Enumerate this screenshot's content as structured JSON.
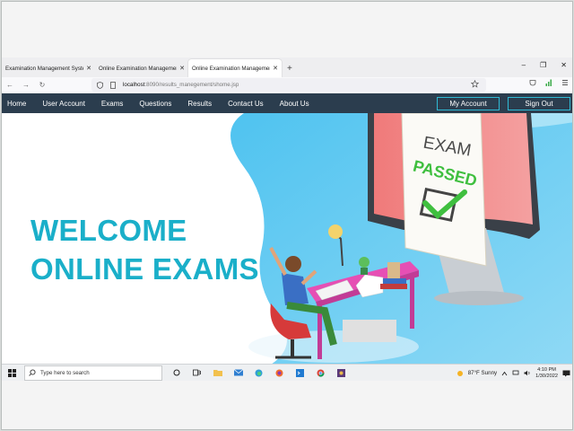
{
  "browser": {
    "tabs": [
      {
        "label": "Examination Management System",
        "active": false
      },
      {
        "label": "Online Examination Management S",
        "active": false
      },
      {
        "label": "Online Examination Management S",
        "active": true
      }
    ],
    "close_glyph": "✕",
    "new_tab_glyph": "+",
    "window_controls": [
      "–",
      "❐",
      "✕"
    ],
    "url_host": "localhost",
    "url_path": ":8090/results_manegement/shome.jsp",
    "nav": {
      "back": "←",
      "forward": "→",
      "reload": "↻"
    }
  },
  "site": {
    "nav_items": [
      "Home",
      "User Account",
      "Exams",
      "Questions",
      "Results",
      "Contact Us",
      "About Us"
    ],
    "my_account": "My Account",
    "sign_out": "Sign Out"
  },
  "hero": {
    "line1": "WELCOME",
    "line2": "ONLINE EXAMS",
    "sign_line1": "EXAM",
    "sign_line2": "PASSED",
    "colors": {
      "accent": "#1aafc9",
      "nav_bg": "#2b3d4e",
      "sign_green": "#3fbf3f",
      "desk_pink": "#e64fb4"
    }
  },
  "taskbar": {
    "search_placeholder": "Type here to search",
    "weather": "87°F  Sunny",
    "time": "4:10 PM",
    "date": "1/30/2022"
  }
}
